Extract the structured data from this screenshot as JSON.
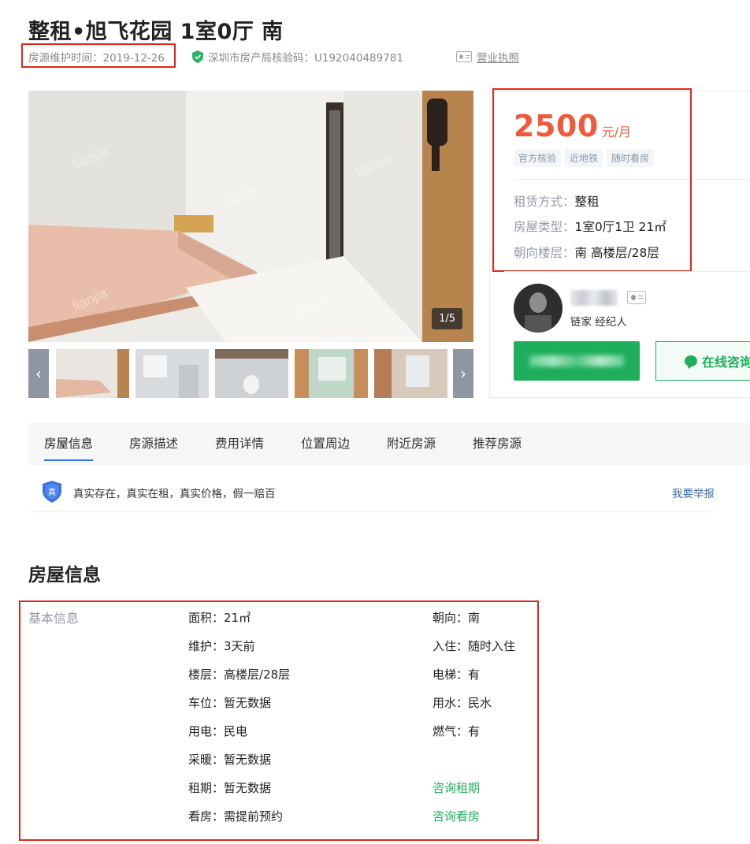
{
  "title": "整租•旭飞花园 1室0厅 南",
  "subheader": {
    "maintenance_time": "房源维护时间：2019-12-26",
    "verify_code": "深圳市房产局核验码：U192040489781",
    "license": "营业执照"
  },
  "gallery": {
    "counter": "1/5",
    "prev_arrow": "‹",
    "next_arrow": "›",
    "thumb_count": 5
  },
  "price": {
    "amount": "2500",
    "unit": "元/月",
    "tags": [
      "官方核验",
      "近地铁",
      "随时看房"
    ],
    "attributes": [
      {
        "label": "租赁方式：",
        "value": "整租"
      },
      {
        "label": "房屋类型：",
        "value": "1室0厅1卫 21㎡"
      },
      {
        "label": "朝向楼层：",
        "value": "南 高楼层/28层"
      }
    ]
  },
  "agent": {
    "role": "链家 经纪人",
    "chat_label": "在线咨询"
  },
  "tabs": [
    "房屋信息",
    "房源描述",
    "费用详情",
    "位置周边",
    "附近房源",
    "推荐房源"
  ],
  "notice": {
    "badge": "真",
    "text": "真实存在，真实在租，真实价格，假一赔百",
    "report": "我要举报"
  },
  "section_title": "房屋信息",
  "basic_info": {
    "group_label": "基本信息",
    "left": [
      {
        "key": "面积：",
        "value": "21㎡"
      },
      {
        "key": "维护：",
        "value": "3天前"
      },
      {
        "key": "楼层：",
        "value": "高楼层/28层"
      },
      {
        "key": "车位：",
        "value": "暂无数据"
      },
      {
        "key": "用电：",
        "value": "民电"
      },
      {
        "key": "采暖：",
        "value": "暂无数据"
      },
      {
        "key": "租期：",
        "value": "暂无数据"
      },
      {
        "key": "看房：",
        "value": "需提前预约"
      }
    ],
    "right": [
      {
        "key": "朝向：",
        "value": "南"
      },
      {
        "key": "入住：",
        "value": "随时入住"
      },
      {
        "key": "电梯：",
        "value": "有"
      },
      {
        "key": "用水：",
        "value": "民水"
      },
      {
        "key": "燃气：",
        "value": "有"
      }
    ],
    "links": [
      "咨询租期",
      "咨询看房"
    ]
  },
  "colors": {
    "price": "#f05a3c",
    "green": "#1fae5b",
    "highlight_box": "#e1251b",
    "tab_underline": "#3072f6"
  }
}
